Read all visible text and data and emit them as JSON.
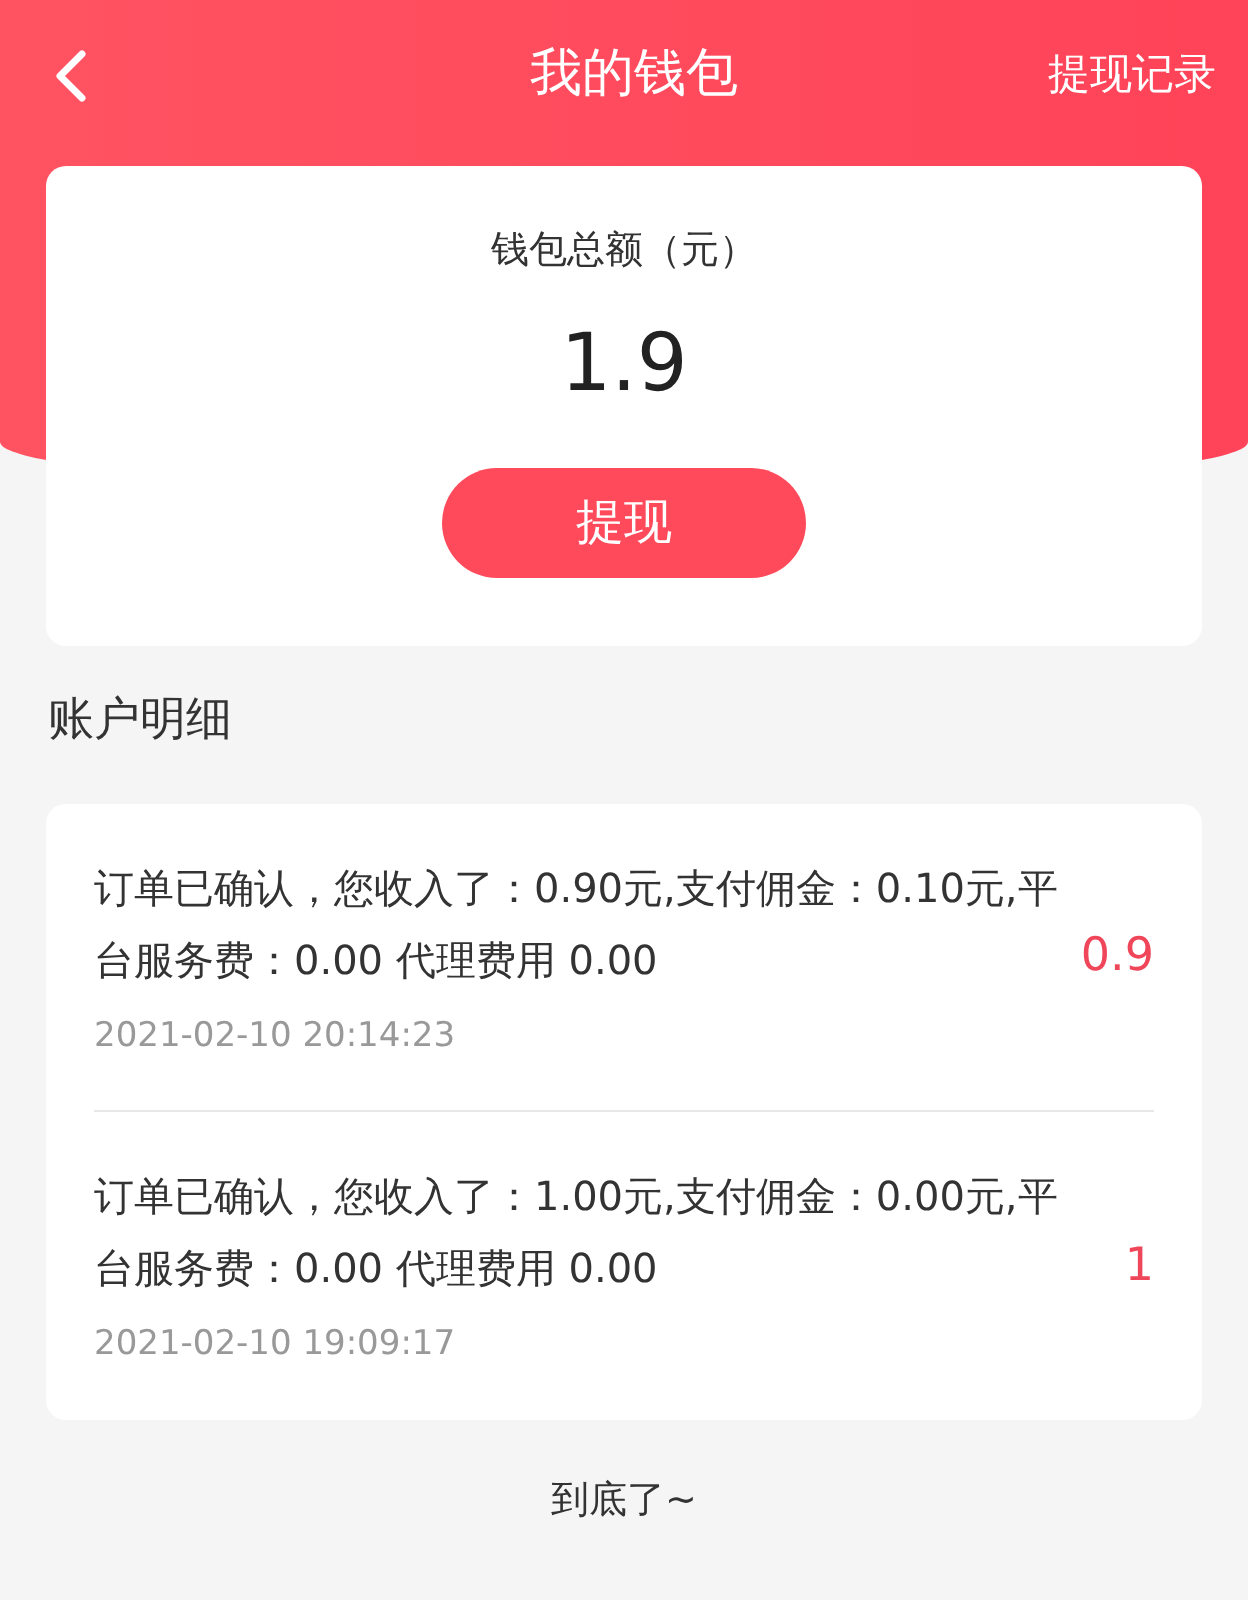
{
  "header": {
    "title": "我的钱包",
    "action": "提现记录"
  },
  "wallet": {
    "label": "钱包总额（元）",
    "amount": "1.9",
    "button": "提现"
  },
  "section_title": "账户明细",
  "transactions": [
    {
      "description": "订单已确认，您收入了：0.90元,支付佣金：0.10元,平台服务费：0.00 代理费用 0.00",
      "time": "2021-02-10 20:14:23",
      "amount": "0.9"
    },
    {
      "description": "订单已确认，您收入了：1.00元,支付佣金：0.00元,平台服务费：0.00 代理费用 0.00",
      "time": "2021-02-10 19:09:17",
      "amount": "1"
    }
  ],
  "footer": "到底了~"
}
